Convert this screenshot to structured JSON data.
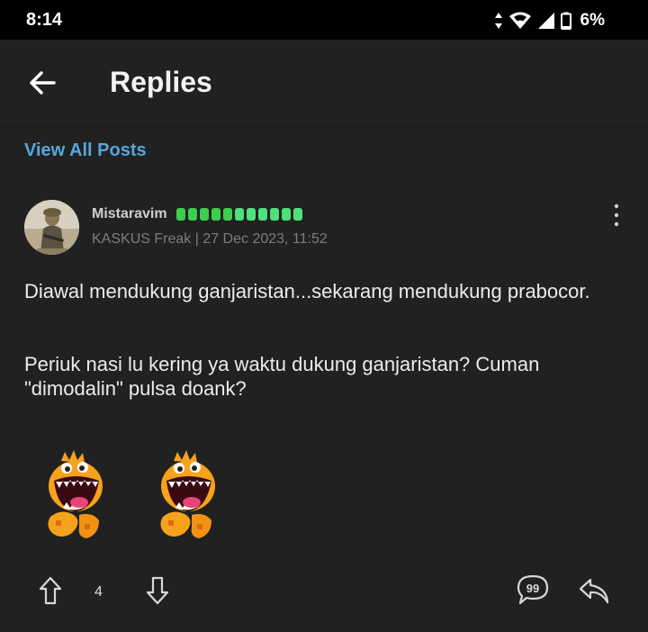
{
  "status": {
    "time": "8:14",
    "battery": "6%"
  },
  "appbar": {
    "title": "Replies"
  },
  "view_all_label": "View All Posts",
  "post": {
    "username": "Mistaravim",
    "rank_dots": 11,
    "meta": "KASKUS Freak | 27 Dec 2023, 11:52",
    "paragraph_1": "Diawal mendukung ganjaristan...sekarang mendukung prabocor.",
    "paragraph_2": "Periuk nasi lu kering ya waktu dukung ganjaristan? Cuman \"dimodalin\" pulsa doank?",
    "vote_count": "4"
  },
  "colors": {
    "background": "#212121",
    "link": "#54a7dc",
    "rank_green": "#3ccf4e",
    "rank_light": "#4ee07a"
  }
}
